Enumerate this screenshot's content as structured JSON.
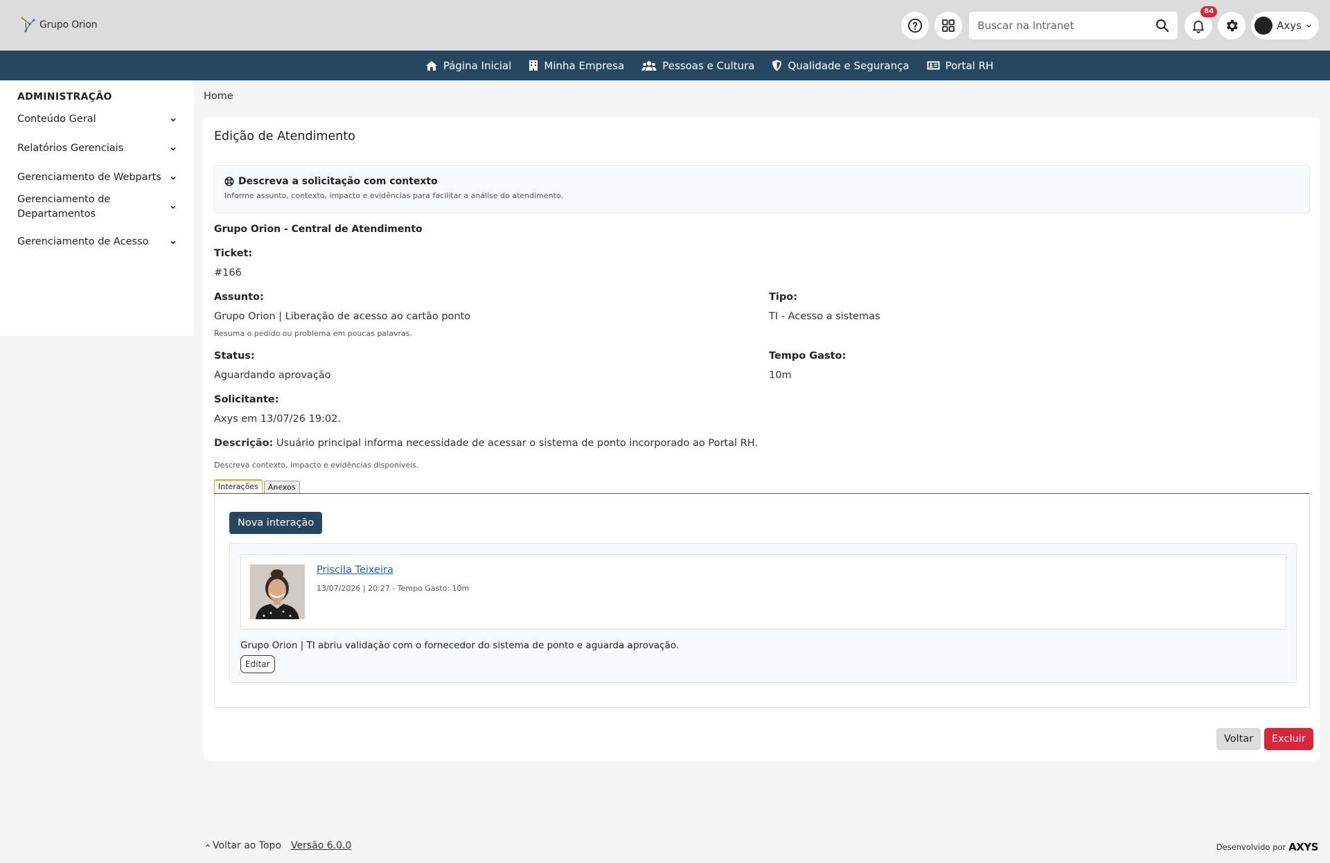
{
  "header": {
    "logo_text": "Grupo Orion",
    "search_placeholder": "Buscar na Intranet",
    "notifications_count": "84",
    "user_name": "Axys"
  },
  "nav": {
    "items": [
      {
        "label": "Página Inicial",
        "icon": "home-icon"
      },
      {
        "label": "Minha Empresa",
        "icon": "building-icon"
      },
      {
        "label": "Pessoas e Cultura",
        "icon": "users-icon"
      },
      {
        "label": "Qualidade e Segurança",
        "icon": "shield-icon"
      },
      {
        "label": "Portal RH",
        "icon": "id-card-icon"
      }
    ]
  },
  "sidebar": {
    "title": "ADMINISTRAÇÃO",
    "items": [
      {
        "label": "Conteúdo Geral"
      },
      {
        "label": "Relatórios Gerenciais"
      },
      {
        "label": "Gerenciamento de Webparts"
      },
      {
        "label": "Gerenciamento de Departamentos"
      },
      {
        "label": "Gerenciamento de Acesso"
      }
    ]
  },
  "breadcrumb": "Home",
  "page": {
    "title": "Edição de Atendimento",
    "info_title": "Descreva a solicitação com contexto",
    "info_sub": "Informe assunto, contexto, impacto e evidências para facilitar a análise do atendimento.",
    "org": "Grupo Orion - Central de Atendimento",
    "ticket_label": "Ticket:",
    "ticket_value": "#166",
    "assunto_label": "Assunto:",
    "assunto_value": "Grupo Orion | Liberação de acesso ao cartão ponto",
    "assunto_hint": "Resuma o pedido ou problema em poucas palavras.",
    "tipo_label": "Tipo:",
    "tipo_value": "TI - Acesso a sistemas",
    "status_label": "Status:",
    "status_value": "Aguardando aprovação",
    "tempo_label": "Tempo Gasto:",
    "tempo_value": "10m",
    "solicitante_label": "Solicitante:",
    "solicitante_value": "Axys em 13/07/26 19:02.",
    "descricao_label": "Descrição:",
    "descricao_value": "Usuário principal informa necessidade de acessar o sistema de ponto incorporado ao Portal RH.",
    "descricao_hint": "Descreva contexto, impacto e evidências disponíveis."
  },
  "tabs": [
    {
      "label": "Interações",
      "active": true
    },
    {
      "label": "Anexos",
      "active": false
    }
  ],
  "interactions": {
    "new_button": "Nova interação",
    "items": [
      {
        "author": "Priscila Teixeira",
        "meta": "13/07/2026 | 20:27 - Tempo Gasto: 10m",
        "text": "Grupo Orion | TI abriu validação com o fornecedor do sistema de ponto e aguarda aprovação.",
        "edit_label": "Editar"
      }
    ]
  },
  "actions": {
    "back": "Voltar",
    "delete": "Excluir"
  },
  "footer": {
    "back_to_top": "Voltar ao Topo",
    "version": "Versão 6.0.0",
    "developed_by": "Desenvolvido por",
    "brand": "AXYS"
  },
  "colors": {
    "navbar": "#274760",
    "primary_button": "#274760",
    "danger": "#d9263a",
    "link": "#1a5fc9",
    "tab_active": "#e8a51b"
  }
}
